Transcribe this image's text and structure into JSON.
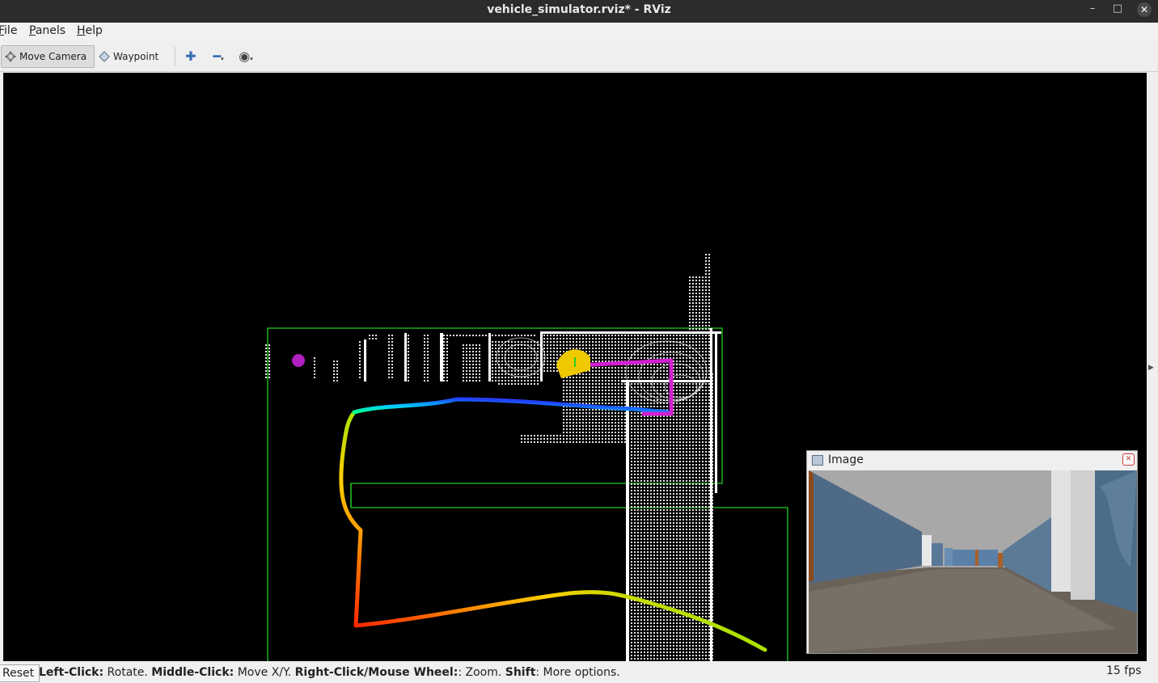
{
  "window": {
    "title": "vehicle_simulator.rviz* - RViz",
    "minimize_icon": "minimize-icon",
    "maximize_icon": "maximize-icon",
    "close_icon": "close-icon"
  },
  "menu": {
    "file_first": "F",
    "file_rest": "ile",
    "panels_first": "P",
    "panels_rest": "anels",
    "help_first": "H",
    "help_rest": "elp"
  },
  "toolbar": {
    "move_camera": "Move Camera",
    "waypoint": "Waypoint",
    "icons": [
      "move-camera-icon",
      "waypoint-icon",
      "add-tool-icon",
      "remove-tool-icon",
      "view-eye-icon"
    ]
  },
  "image_panel": {
    "title": "Image"
  },
  "status": {
    "reset": "Reset",
    "left_click_label": "Left-Click:",
    "left_click_action": " Rotate. ",
    "middle_click_label": "Middle-Click:",
    "middle_click_action": " Move X/Y. ",
    "right_click_label": "Right-Click/Mouse Wheel:",
    "right_click_action": ": Zoom. ",
    "shift_label": "Shift",
    "shift_action": ": More options.",
    "fps": "15 fps"
  },
  "colors": {
    "boundary_green": "#22cc22",
    "goal_marker": "#b020c0",
    "vehicle_marker": "#f0c800",
    "path_magenta": "#d020d0",
    "trajectory_start": "#ff0000",
    "trajectory_end": "#8020ff"
  }
}
